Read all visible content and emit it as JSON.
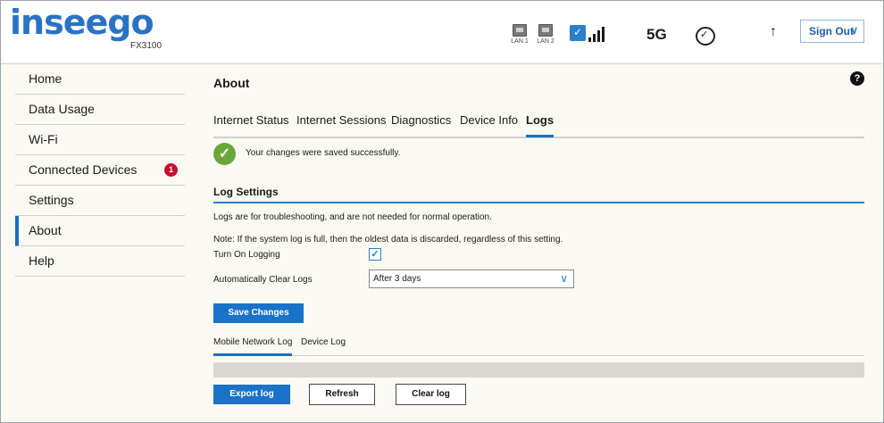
{
  "header": {
    "logo": "inseego",
    "model": "FX3100",
    "lan1": "LAN 1",
    "lan2": "LAN 2",
    "network": "5G",
    "sign_out": "Sign Out"
  },
  "sidebar": {
    "items": [
      {
        "label": "Home"
      },
      {
        "label": "Data Usage"
      },
      {
        "label": "Wi-Fi"
      },
      {
        "label": "Connected Devices",
        "badge": "1"
      },
      {
        "label": "Settings"
      },
      {
        "label": "About",
        "active": true
      },
      {
        "label": "Help"
      }
    ]
  },
  "main": {
    "title": "About",
    "tabs": [
      {
        "label": "Internet Status"
      },
      {
        "label": "Internet Sessions"
      },
      {
        "label": "Diagnostics"
      },
      {
        "label": "Device Info"
      },
      {
        "label": "Logs",
        "active": true
      }
    ],
    "success_message": "Your changes were saved successfully.",
    "log_settings": {
      "title": "Log Settings",
      "desc": "Logs are for troubleshooting, and are not needed for normal operation.",
      "note": "Note: If the system log is full, then the oldest data is discarded, regardless of this setting.",
      "turn_on_label": "Turn On Logging",
      "turn_on_checked": true,
      "auto_clear_label": "Automatically Clear Logs",
      "auto_clear_value": "After 3 days",
      "save_button": "Save Changes"
    },
    "log_tabs": [
      {
        "label": "Mobile Network Log",
        "active": true
      },
      {
        "label": "Device Log"
      }
    ],
    "buttons": {
      "export": "Export log",
      "refresh": "Refresh",
      "clear": "Clear log"
    }
  },
  "colors": {
    "accent": "#1a73c8",
    "badge": "#c8102e",
    "success": "#6aa73a"
  }
}
